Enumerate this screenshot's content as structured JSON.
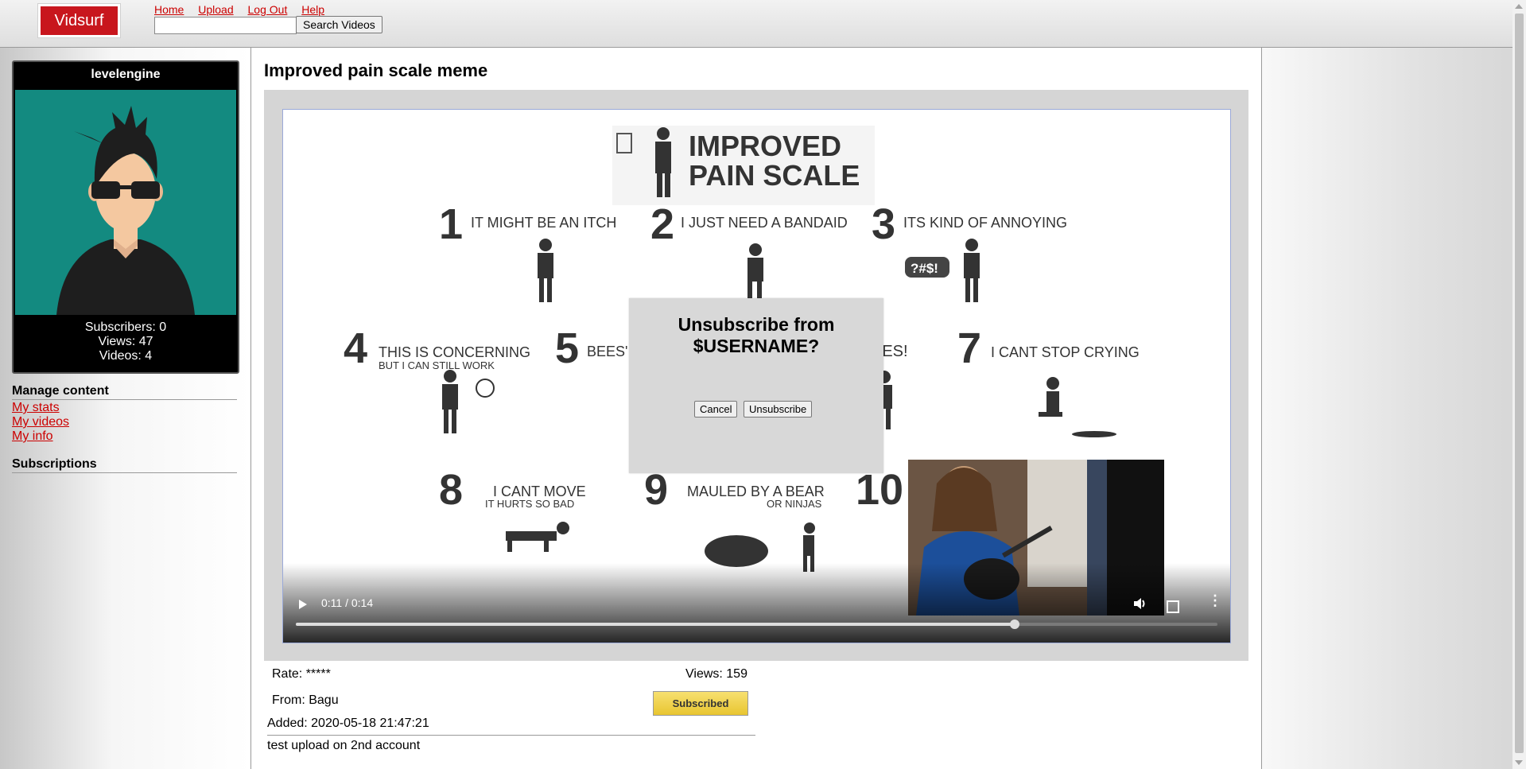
{
  "header": {
    "logo_text": "Vidsurf",
    "nav": [
      "Home",
      "Upload",
      "Log Out",
      "Help"
    ],
    "search_placeholder": "",
    "search_button": "Search Videos"
  },
  "profile": {
    "username": "levelengine",
    "subscribers": "Subscribers: 0",
    "views": "Views: 47",
    "videos": "Videos: 4"
  },
  "sidebar": {
    "manage_title": "Manage content",
    "links": [
      "My stats",
      "My videos",
      "My info"
    ],
    "subscriptions_title": "Subscriptions"
  },
  "video": {
    "title": "Improved pain scale meme",
    "time": "0:11 / 0:14",
    "progress": 0.78,
    "meme": {
      "heading_1": "IMPROVED",
      "heading_2": "PAIN SCALE",
      "items": [
        {
          "num": "1",
          "text": "IT MIGHT BE AN ITCH",
          "sub": ""
        },
        {
          "num": "2",
          "text": "I JUST NEED A BANDAID",
          "sub": ""
        },
        {
          "num": "3",
          "text": "ITS KIND OF ANNOYING",
          "sub": ""
        },
        {
          "num": "4",
          "text": "THIS IS CONCERNING",
          "sub": "BUT I CAN STILL WORK"
        },
        {
          "num": "5",
          "text": "BEES'",
          "sub": ""
        },
        {
          "num": "7",
          "text": "I CANT STOP CRYING",
          "sub": ""
        },
        {
          "num": "8",
          "text": "I CANT MOVE",
          "sub": "IT HURTS SO BAD"
        },
        {
          "num": "9",
          "text": "MAULED BY A BEAR",
          "sub": "OR NINJAS"
        },
        {
          "num": "10",
          "text": "",
          "sub": ""
        }
      ],
      "fragment": "EES!",
      "symbols": "?#$!"
    }
  },
  "modal": {
    "line1": "Unsubscribe from",
    "line2": "$USERNAME?",
    "cancel": "Cancel",
    "confirm": "Unsubscribe"
  },
  "info": {
    "rate": "Rate: *****",
    "views": "Views: 159",
    "from": "From: Bagu",
    "subscribed": "Subscribed",
    "added": "Added: 2020-05-18 21:47:21",
    "description": "test upload on 2nd account"
  },
  "colors": {
    "brand": "#c8161d",
    "avatar_bg": "#138a80",
    "subscribed_button": "#f0d44c"
  }
}
